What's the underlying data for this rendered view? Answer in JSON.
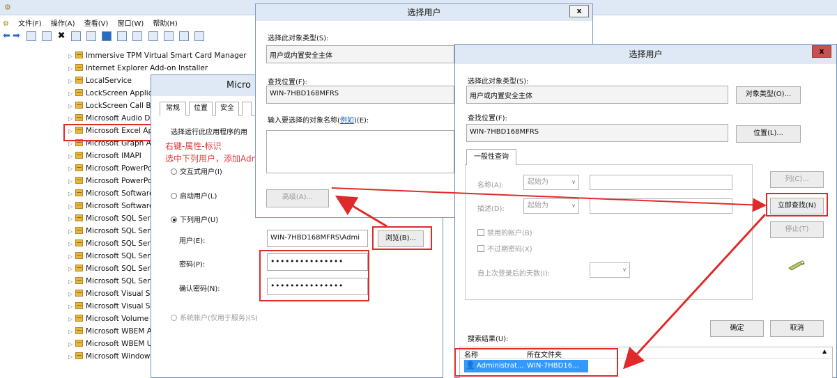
{
  "main": {
    "menu": [
      "文件(F)",
      "操作(A)",
      "查看(V)",
      "窗口(W)",
      "帮助(H)"
    ],
    "tree_items": [
      "Immersive TPM Virtual Smart Card Manager",
      "Internet Explorer Add-on Installer",
      "LocalService",
      "LockScreen Applica",
      "LockScreen Call Br",
      "Microsoft Audio De",
      "Microsoft Excel Ap",
      "Microsoft Graph A",
      "Microsoft IMAPI",
      "Microsoft PowerPo",
      "Microsoft PowerPo",
      "Microsoft Software",
      "Microsoft Software",
      "Microsoft SQL Serv",
      "Microsoft SQL Serv",
      "Microsoft SQL Serv",
      "Microsoft SQL Serv",
      "Microsoft SQL Serv",
      "Microsoft SQL Serv",
      "Microsoft Visual St",
      "Microsoft Visual St",
      "Microsoft Volume",
      "Microsoft WBEM A",
      "Microsoft WBEM U",
      "Microsoft Window"
    ]
  },
  "props": {
    "title": "Micro",
    "tabs": [
      "常规",
      "位置",
      "安全"
    ],
    "prompt": "选择运行此应用程序的用",
    "radio_interactive": "交互式用户(I)",
    "radio_launching": "启动用户(L)",
    "radio_this_user": "下列用户(U)",
    "user_label": "用户(E):",
    "user_value": "WIN-7HBD168MFRS\\Admi",
    "browse_button": "浏览(B)...",
    "password_label": "密码(P):",
    "password_value": "•••••••••••••••",
    "confirm_label": "确认密码(N):",
    "confirm_value": "•••••••••••••••",
    "system_account": "系统帐户(仅用于服务)(S)"
  },
  "annotation": {
    "line1": "右键-属性-标识",
    "line2": "选中下列用户，添加Administrator用户，密码为pc登录的密码"
  },
  "select_small": {
    "title": "选择用户",
    "close": "x",
    "object_type_label": "选择此对象类型(S):",
    "object_type_value": "用户或内置安全主体",
    "location_label": "查找位置(F):",
    "location_value": "WIN-7HBD168MFRS",
    "enter_names_label_pre": "输入要选择的对象名称(",
    "enter_names_link": "例如",
    "enter_names_label_post": ")(E):",
    "advanced_button": "高级(A)..."
  },
  "select_large": {
    "title": "选择用户",
    "close": "x",
    "object_type_label": "选择此对象类型(S):",
    "object_type_value": "用户或内置安全主体",
    "object_types_button": "对象类型(O)...",
    "location_label": "查找位置(F):",
    "location_value": "WIN-7HBD168MFRS",
    "locations_button": "位置(L)...",
    "tab_label": "一般性查询",
    "name_label": "名称(A):",
    "name_combo": "起始为",
    "desc_label": "描述(D):",
    "desc_combo": "起始为",
    "disabled_accounts": "禁用的帐户(B)",
    "non_expiring": "不过期密码(X)",
    "days_label": "自上次登录后的天数(I):",
    "columns_button": "列(C)...",
    "find_now_button": "立即查找(N)",
    "stop_button": "停止(T)",
    "results_label": "搜索结果(U):",
    "ok_button": "确定",
    "cancel_button": "取消",
    "col_name": "名称",
    "col_folder": "所在文件夹",
    "result_name": "Administrat...",
    "result_folder": "WIN-7HBD16..."
  },
  "colors": {
    "accent_red": "#e02a2a",
    "selection_blue": "#3399ff",
    "title_bar": "#dfe9f5"
  }
}
